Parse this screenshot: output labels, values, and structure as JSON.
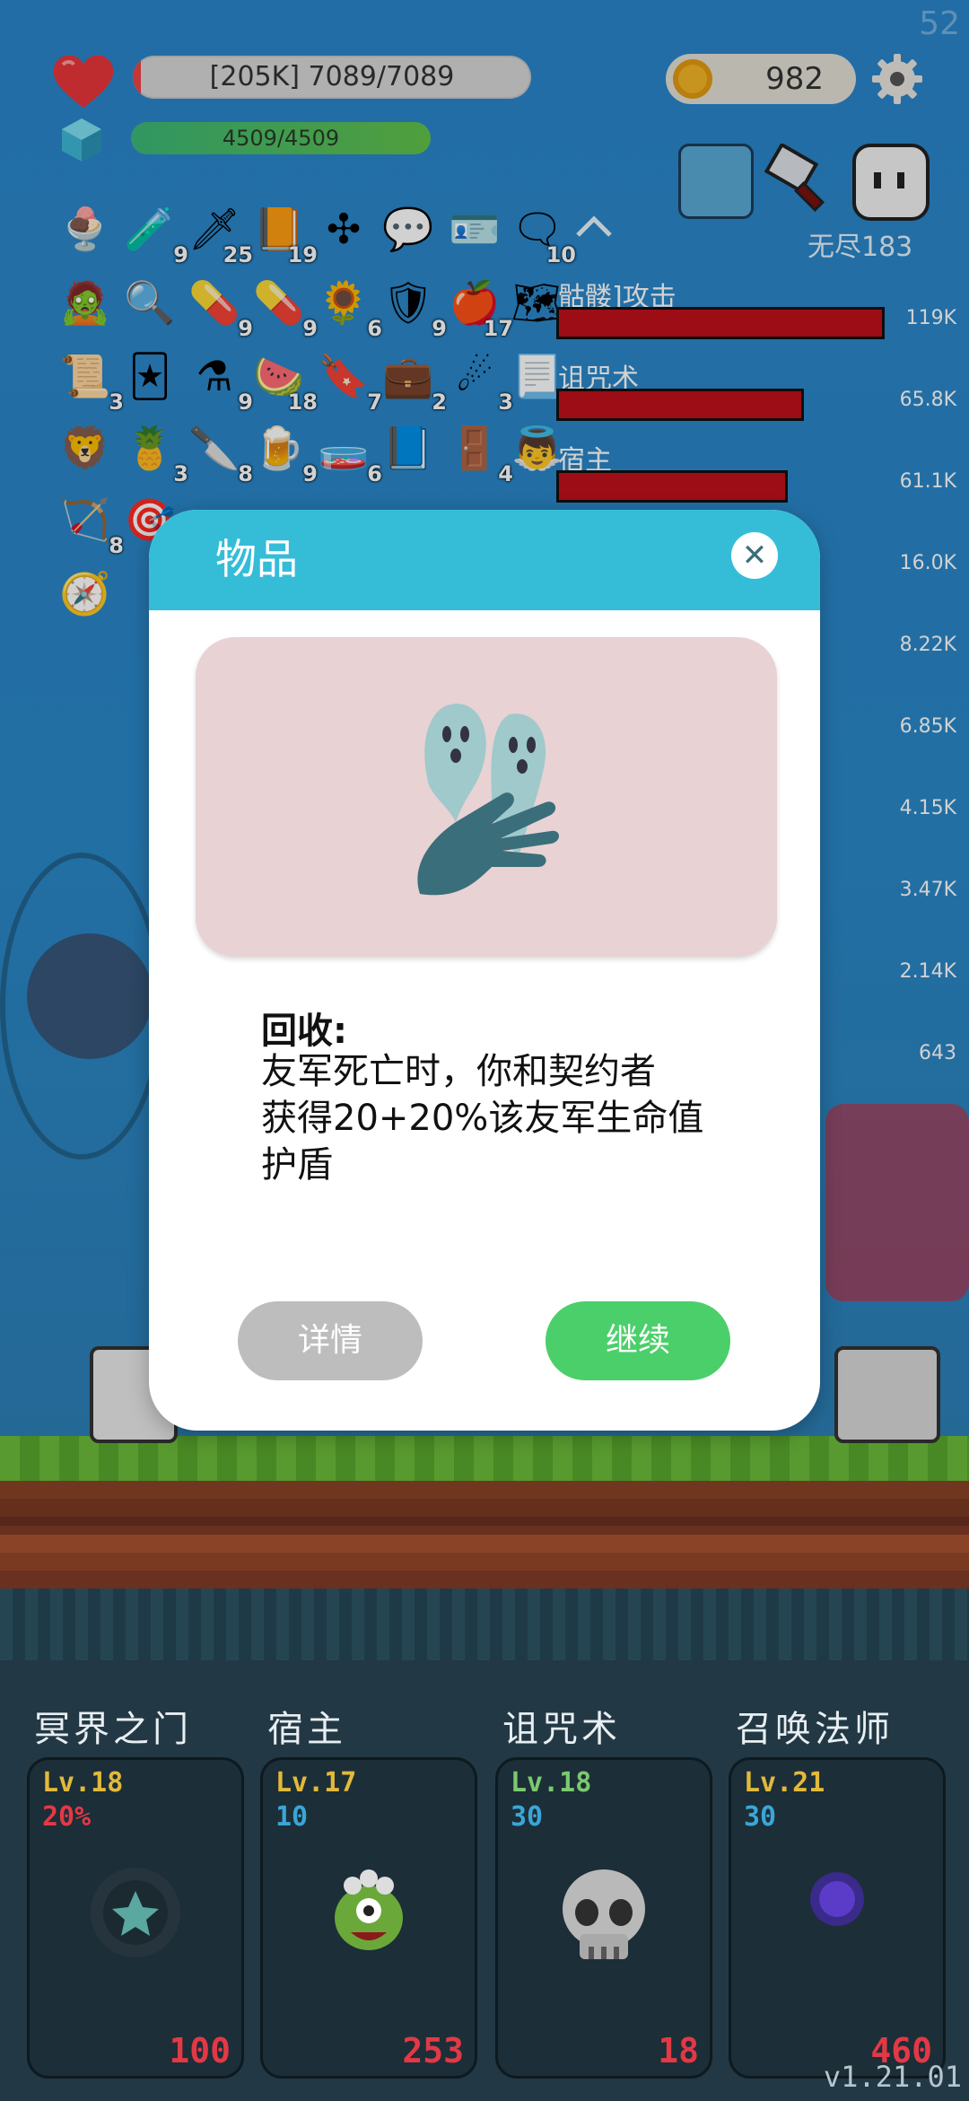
{
  "hud": {
    "fps": "52",
    "hp_text": "[205K] 7089/7089",
    "mp_text": "4509/4509",
    "coins": "982",
    "endless_label": "无尽183",
    "colors": {
      "hp": "#e44444",
      "mp": "#3cb878",
      "accent": "#35bdd8"
    }
  },
  "items": [
    {
      "icon": "ice-cream-icon",
      "glyph": "🍨",
      "count": ""
    },
    {
      "icon": "potion-bottle-icon",
      "glyph": "🧪",
      "count": "9"
    },
    {
      "icon": "sword-icon",
      "glyph": "🗡",
      "count": "25"
    },
    {
      "icon": "book-icon",
      "glyph": "📙",
      "count": "19"
    },
    {
      "icon": "crystal-cluster-icon",
      "glyph": "✣",
      "count": ""
    },
    {
      "icon": "speech-bubble-icon",
      "glyph": "💬",
      "count": ""
    },
    {
      "icon": "id-card-icon",
      "glyph": "🪪",
      "count": ""
    },
    {
      "icon": "chat-bubble-icon",
      "glyph": "🗨",
      "count": "10"
    },
    {
      "icon": "zombie-face-icon",
      "glyph": "🧟",
      "count": ""
    },
    {
      "icon": "magnifier-icon",
      "glyph": "🔍",
      "count": ""
    },
    {
      "icon": "red-pill-icon",
      "glyph": "💊",
      "count": "9"
    },
    {
      "icon": "blue-pill-icon",
      "glyph": "💊",
      "count": "9"
    },
    {
      "icon": "sunflower-icon",
      "glyph": "🌻",
      "count": "6"
    },
    {
      "icon": "shield-round-icon",
      "glyph": "🛡",
      "count": "9"
    },
    {
      "icon": "apple-icon",
      "glyph": "🍎",
      "count": "17"
    },
    {
      "icon": "map-icon",
      "glyph": "🗺",
      "count": ""
    },
    {
      "icon": "scroll-icon",
      "glyph": "📜",
      "count": "3"
    },
    {
      "icon": "cards-icon",
      "glyph": "🃏",
      "count": ""
    },
    {
      "icon": "flask-icon",
      "glyph": "⚗",
      "count": "9"
    },
    {
      "icon": "watermelon-icon",
      "glyph": "🍉",
      "count": "18"
    },
    {
      "icon": "banner-icon",
      "glyph": "🔖",
      "count": "7"
    },
    {
      "icon": "briefcase-icon",
      "glyph": "💼",
      "count": "2"
    },
    {
      "icon": "meteor-icon",
      "glyph": "☄",
      "count": "3"
    },
    {
      "icon": "parchment-icon",
      "glyph": "📃",
      "count": ""
    },
    {
      "icon": "lion-shield-icon",
      "glyph": "🦁",
      "count": ""
    },
    {
      "icon": "pineapple-icon",
      "glyph": "🍍",
      "count": "3"
    },
    {
      "icon": "dagger-icon",
      "glyph": "🔪",
      "count": "8"
    },
    {
      "icon": "beer-icon",
      "glyph": "🍺",
      "count": "9"
    },
    {
      "icon": "green-flask-icon",
      "glyph": "🧫",
      "count": "6"
    },
    {
      "icon": "bible-icon",
      "glyph": "📘",
      "count": ""
    },
    {
      "icon": "door-icon",
      "glyph": "🚪",
      "count": "4"
    },
    {
      "icon": "angel-statue-icon",
      "glyph": "👼",
      "count": ""
    },
    {
      "icon": "bow-icon",
      "glyph": "🏹",
      "count": "8"
    },
    {
      "icon": "target-icon",
      "glyph": "🎯",
      "count": ""
    },
    {
      "icon": "compass-icon",
      "glyph": "🧭",
      "count": ""
    }
  ],
  "damage": [
    {
      "label": "骷髅]攻击",
      "value": "119K",
      "fill": 1.0
    },
    {
      "label": "诅咒术",
      "value": "65.8K",
      "fill": 0.75
    },
    {
      "label": "宿主",
      "value": "61.1K",
      "fill": 0.7
    },
    {
      "label": "",
      "value": "16.0K",
      "fill": 0
    },
    {
      "label": "",
      "value": "8.22K",
      "fill": 0
    },
    {
      "label": "",
      "value": "6.85K",
      "fill": 0
    },
    {
      "label": "",
      "value": "4.15K",
      "fill": 0
    },
    {
      "label": "",
      "value": "3.47K",
      "fill": 0
    },
    {
      "label": "",
      "value": "2.14K",
      "fill": 0
    },
    {
      "label": "",
      "value": "643",
      "fill": 0
    }
  ],
  "modal": {
    "title": "物品",
    "close_icon": "close-icon",
    "item_icon": "ghost-hand-icon",
    "desc_title": "回收:",
    "desc_lines": [
      "友军死亡时，你和契约者",
      "获得20+20%该友军生命值",
      "护盾"
    ],
    "detail_label": "详情",
    "continue_label": "继续"
  },
  "skills": [
    {
      "name": "冥界之门",
      "level": "Lv.18",
      "sub": "20%",
      "sub_color": "#e33846",
      "count": "100",
      "icon": "portal-icon",
      "lv_color": "#e2b93b"
    },
    {
      "name": "宿主",
      "level": "Lv.17",
      "sub": "10",
      "sub_color": "#3aa6d8",
      "count": "253",
      "icon": "green-monster-icon",
      "lv_color": "#e2b93b"
    },
    {
      "name": "诅咒术",
      "level": "Lv.18",
      "sub": "30",
      "sub_color": "#3aa6d8",
      "count": "18",
      "icon": "skull-icon",
      "lv_color": "#7bc96f"
    },
    {
      "name": "召唤法师",
      "level": "Lv.21",
      "sub": "30",
      "sub_color": "#3aa6d8",
      "count": "460",
      "icon": "dark-orb-icon",
      "lv_color": "#e2b93b"
    }
  ],
  "version": "v1.21.01"
}
